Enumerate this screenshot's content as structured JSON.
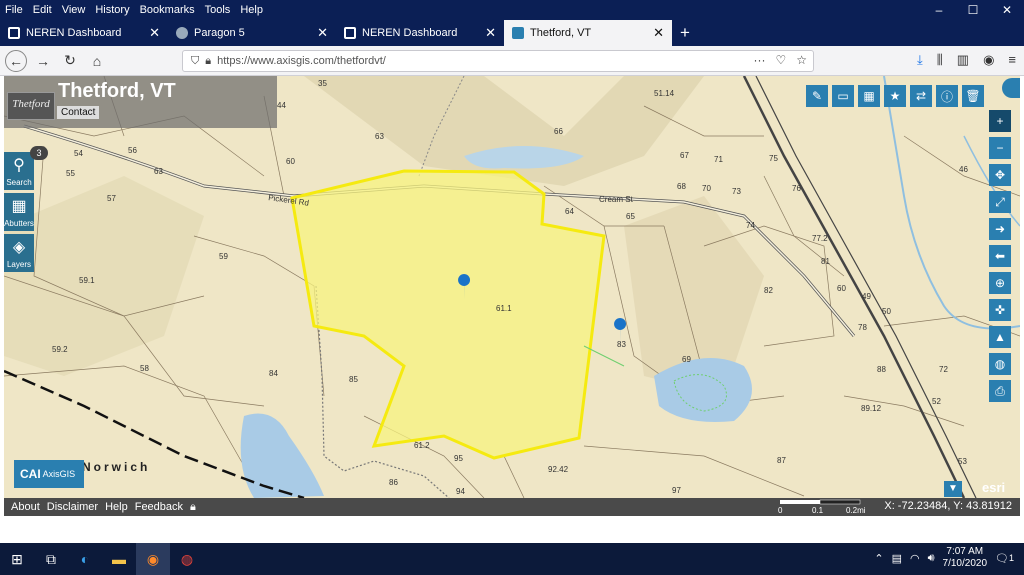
{
  "menu": [
    "File",
    "Edit",
    "View",
    "History",
    "Bookmarks",
    "Tools",
    "Help"
  ],
  "window_controls": {
    "minimize": "–",
    "maximize": "☐",
    "close": "✕"
  },
  "tabs": [
    {
      "label": "NEREN Dashboard",
      "icon_color": "#ffffff",
      "active": false
    },
    {
      "label": "Paragon 5",
      "icon_color": "#9ab",
      "active": false
    },
    {
      "label": "NEREN Dashboard",
      "icon_color": "#ffffff",
      "active": false
    },
    {
      "label": "Thetford, VT",
      "icon_color": "#2a7fb0",
      "active": true
    }
  ],
  "address": {
    "url": "https://www.axisgis.com/thetfordvt/"
  },
  "map": {
    "title": "Thetford, VT",
    "logo_text": "Thetford",
    "contact": "Contact",
    "buttons": {
      "search": "Search",
      "abutters": "Abutters",
      "layers": "Layers"
    },
    "search_badge": "3",
    "town_label": "Norwich",
    "road_labels": [
      "Pickerel Rd",
      "Cream St"
    ],
    "highlight_color": "#f5f07a",
    "parcel_labels": [
      "35",
      "44",
      "51.14",
      "63",
      "60",
      "66",
      "67",
      "71",
      "75",
      "54",
      "56",
      "55",
      "63",
      "57",
      "68",
      "70",
      "73",
      "76",
      "64",
      "65",
      "46",
      "74",
      "77.2",
      "59",
      "59.1",
      "81",
      "82",
      "61.1",
      "60",
      "49",
      "50",
      "59.2",
      "58",
      "78",
      "83",
      "69",
      "84",
      "85",
      "88",
      "89.12",
      "52",
      "61.2",
      "95",
      "92.42",
      "87",
      "86",
      "97",
      "94",
      "53",
      "72"
    ],
    "vendor_logo": "CAI",
    "vendor_logo_sub": "AxisGIS",
    "esri": "esri"
  },
  "footer": {
    "links": [
      "About",
      "Disclaimer",
      "Help",
      "Feedback"
    ],
    "scale": [
      "0",
      "0.1",
      "0.2mi"
    ],
    "coords": "X: -72.23484, Y: 43.81912"
  },
  "taskbar": {
    "time": "7:07 AM",
    "date": "7/10/2020",
    "notifications": "1"
  }
}
